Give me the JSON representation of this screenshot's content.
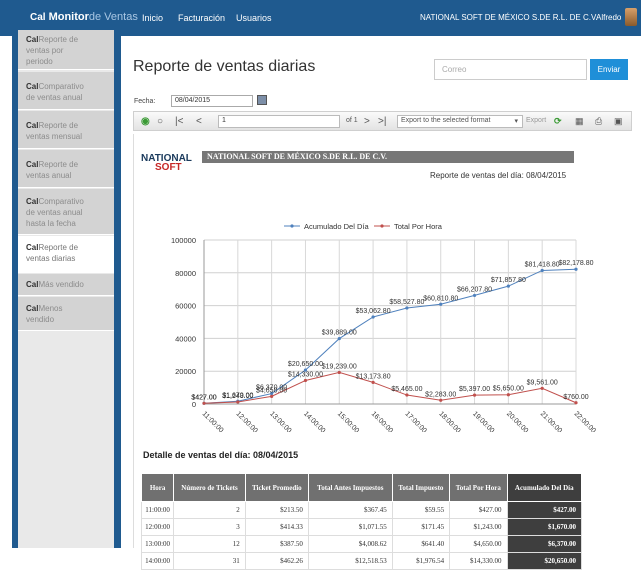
{
  "topbar": {
    "logo_icon": "Cal",
    "logo_bold": "Monitor",
    "logo_light": "de Ventas",
    "nav": [
      "Inicio",
      "Facturación",
      "Usuarios"
    ],
    "company": "NATIONAL SOFT DE MÉXICO S.DE R.L. DE C.V.",
    "user": "Alfredo"
  },
  "sidebar": {
    "items": [
      {
        "l1": "Reporte de",
        "l2": "ventas por",
        "l3": "periodo"
      },
      {
        "l1": "Comparativo",
        "l2": "de ventas anual",
        "l3": ""
      },
      {
        "l1": "Reporte de",
        "l2": "ventas mensual",
        "l3": ""
      },
      {
        "l1": "Reporte de",
        "l2": "ventas anual",
        "l3": ""
      },
      {
        "l1": "Comparativo",
        "l2": "de ventas anual",
        "l3": "hasta la fecha"
      },
      {
        "l1": "Reporte de",
        "l2": "ventas diarias",
        "l3": ""
      },
      {
        "l1": "Más vendido",
        "l2": "",
        "l3": ""
      },
      {
        "l1": "Menos",
        "l2": "vendido",
        "l3": ""
      }
    ]
  },
  "main": {
    "title": "Reporte de ventas diarias",
    "email_placeholder": "Correo",
    "send_label": "Enviar",
    "date_label": "Fecha:",
    "date_value": "08/04/2015"
  },
  "toolbar": {
    "page_value": "1",
    "of_label": "of 1",
    "format_label": "Export to the selected format",
    "export_label": "Export"
  },
  "report": {
    "logo_top": "NATIONAL",
    "logo_bottom": "SOFT",
    "company_header": "NATIONAL SOFT DE MÉXICO S.DE R.L. DE C.V.",
    "subtitle": "Reporte de ventas del día: 08/04/2015",
    "detail_title": "Detalle de ventas del día: 08/04/2015"
  },
  "chart_data": {
    "type": "line",
    "categories": [
      "11:00:00",
      "12:00:00",
      "13:00:00",
      "14:00:00",
      "15:00:00",
      "16:00:00",
      "17:00:00",
      "18:00:00",
      "19:00:00",
      "20:00:00",
      "21:00:00",
      "22:00:00"
    ],
    "series": [
      {
        "name": "Acumulado Del Día",
        "color": "#4f81bd",
        "values": [
          427,
          1670,
          6370,
          20650,
          39889,
          53062.8,
          58527.8,
          60810.8,
          66207.8,
          71857.8,
          81418.8,
          82178.8
        ],
        "labels": [
          "$427.00",
          "$1,670.00",
          "$6,370.00",
          "$20,650.00",
          "$39,889.00",
          "$53,062.80",
          "$58,527.80",
          "$60,810.80",
          "$66,207.80",
          "$71,857.80",
          "$81,418.80",
          "$82,178.80"
        ]
      },
      {
        "name": "Total Por Hora",
        "color": "#c0504d",
        "values": [
          427,
          1243,
          4650,
          14330,
          19239,
          13173.8,
          5465,
          2283,
          5397,
          5650,
          9561,
          760
        ],
        "labels": [
          "$427.00",
          "$1,243.00",
          "$4,650.00",
          "$14,330.00",
          "$19,239.00",
          "$13,173.80",
          "$5,465.00",
          "$2,283.00",
          "$5,397.00",
          "$5,650.00",
          "$9,561.00",
          "$760.00"
        ]
      }
    ],
    "yticks": [
      "0",
      "20000",
      "40000",
      "60000",
      "80000",
      "100000"
    ],
    "ylim": [
      0,
      100000
    ],
    "grid": true,
    "legend": "top"
  },
  "table": {
    "headers": [
      "Hora",
      "Número de Tickets",
      "Ticket Promedio",
      "Total Antes Impuestos",
      "Total Impuesto",
      "Total Por Hora",
      "Acumulado Del Día"
    ],
    "rows": [
      [
        "11:00:00",
        "2",
        "$213.50",
        "$367.45",
        "$59.55",
        "$427.00",
        "$427.00"
      ],
      [
        "12:00:00",
        "3",
        "$414.33",
        "$1,071.55",
        "$171.45",
        "$1,243.00",
        "$1,670.00"
      ],
      [
        "13:00:00",
        "12",
        "$387.50",
        "$4,008.62",
        "$641.40",
        "$4,650.00",
        "$6,370.00"
      ],
      [
        "14:00:00",
        "31",
        "$462.26",
        "$12,518.53",
        "$1,976.54",
        "$14,330.00",
        "$20,650.00"
      ]
    ]
  }
}
